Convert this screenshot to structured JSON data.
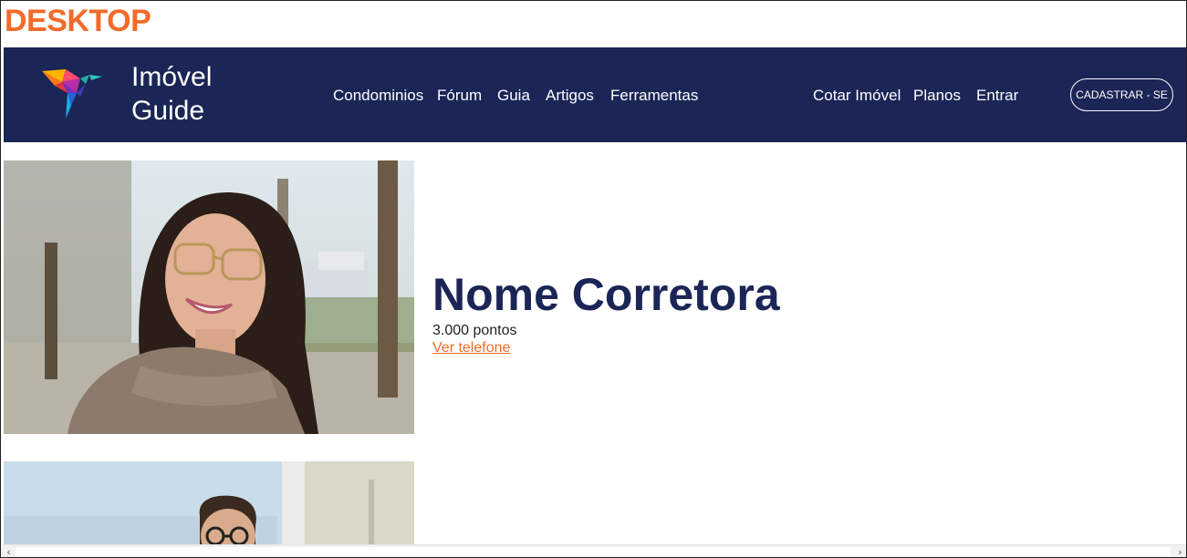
{
  "page_label": "DESKTOP",
  "brand": {
    "line1": "Imóvel",
    "line2": "Guide"
  },
  "nav": {
    "primary": [
      "Condominios",
      "Fórum",
      "Guia",
      "Artigos",
      "Ferramentas"
    ],
    "secondary": [
      "Cotar Imóvel",
      "Planos",
      "Entrar"
    ],
    "cta": "CADASTRAR - SE"
  },
  "agent": {
    "name": "Nome Corretora",
    "points": "3.000 pontos",
    "phone_link": "Ver telefone"
  },
  "colors": {
    "accent": "#f26b2a",
    "navy": "#1b2556"
  },
  "icons": {
    "logo": "hummingbird-logo-icon",
    "scroll_left": "chevron-left-icon",
    "scroll_right": "chevron-right-icon"
  }
}
